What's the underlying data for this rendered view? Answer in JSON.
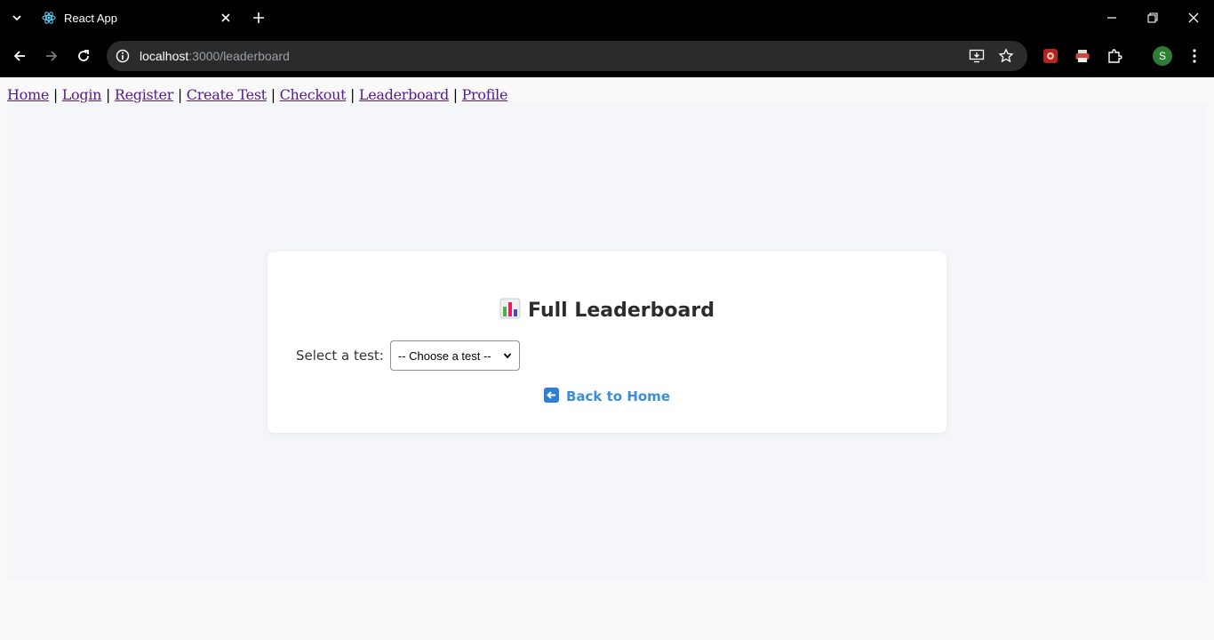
{
  "browser": {
    "tab_title": "React App",
    "url_host": "localhost",
    "url_path": ":3000/leaderboard",
    "profile_initial": "S"
  },
  "nav": {
    "links": [
      "Home",
      "Login",
      "Register",
      "Create Test",
      "Checkout",
      "Leaderboard",
      "Profile"
    ],
    "separator": "|"
  },
  "leaderboard": {
    "title": "Full Leaderboard",
    "title_icon": "bar-chart-icon",
    "select_label": "Select a test:",
    "select_value": "-- Choose a test --",
    "back_link": "Back to Home",
    "back_icon": "back-arrow-icon"
  },
  "colors": {
    "link_visited": "#551a8b",
    "back_link": "#3a8fd8",
    "content_bg": "#f4f6f9",
    "card_bg": "#ffffff"
  }
}
